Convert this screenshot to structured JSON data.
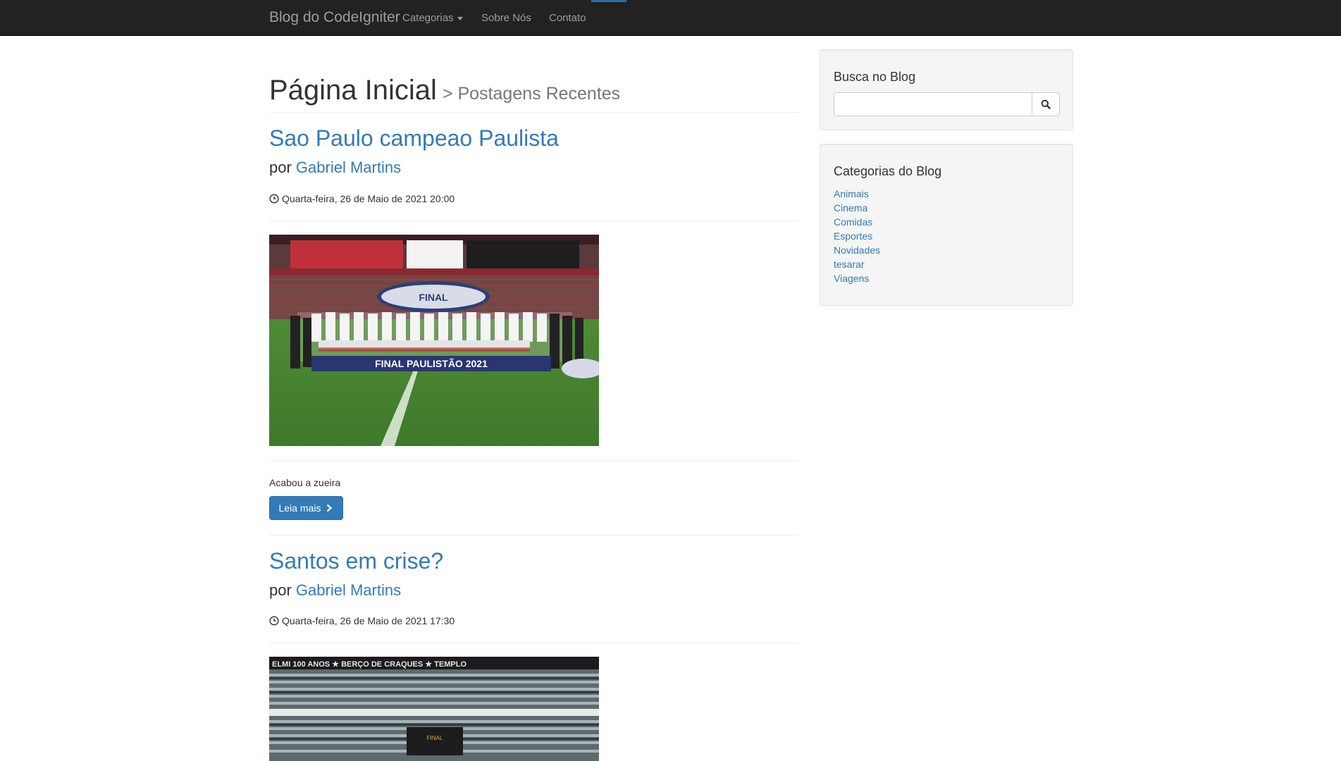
{
  "navbar": {
    "brand": "Blog do CodeIgniter",
    "items": [
      {
        "label": "Categorias",
        "dropdown": true
      },
      {
        "label": "Sobre Nós"
      },
      {
        "label": "Contato"
      }
    ]
  },
  "header": {
    "title": "Página Inicial",
    "subtitle": "> Postagens Recentes"
  },
  "posts": [
    {
      "title": "Sao Paulo campeao Paulista",
      "author_prefix": "por",
      "author": "Gabriel Martins",
      "date": "Quarta-feira, 26 de Maio de 2021 20:00",
      "image_caption": "FINAL PAULISTÃO 2021",
      "excerpt": "Acabou a zueira",
      "button": "Leia mais"
    },
    {
      "title": "Santos em crise?",
      "author_prefix": "por",
      "author": "Gabriel Martins",
      "date": "Quarta-feira, 26 de Maio de 2021 17:30",
      "image_caption": "ELMI 100 ANOS ★ BERÇO DE CRAQUES ★ TEMPLO"
    }
  ],
  "sidebar": {
    "search": {
      "title": "Busca no Blog",
      "placeholder": "",
      "value": ""
    },
    "categories": {
      "title": "Categorias do Blog",
      "items": [
        "Animais",
        "Cinema",
        "Comidas",
        "Esportes",
        "Novidades",
        "tesarar",
        "Viagens"
      ]
    }
  },
  "colors": {
    "navbar_bg": "#222222",
    "link": "#337ab7",
    "button_primary": "#337ab7",
    "well_bg": "#f5f5f5"
  },
  "icons": [
    "clock-icon",
    "chevron-right-icon",
    "search-icon",
    "caret-down-icon"
  ]
}
